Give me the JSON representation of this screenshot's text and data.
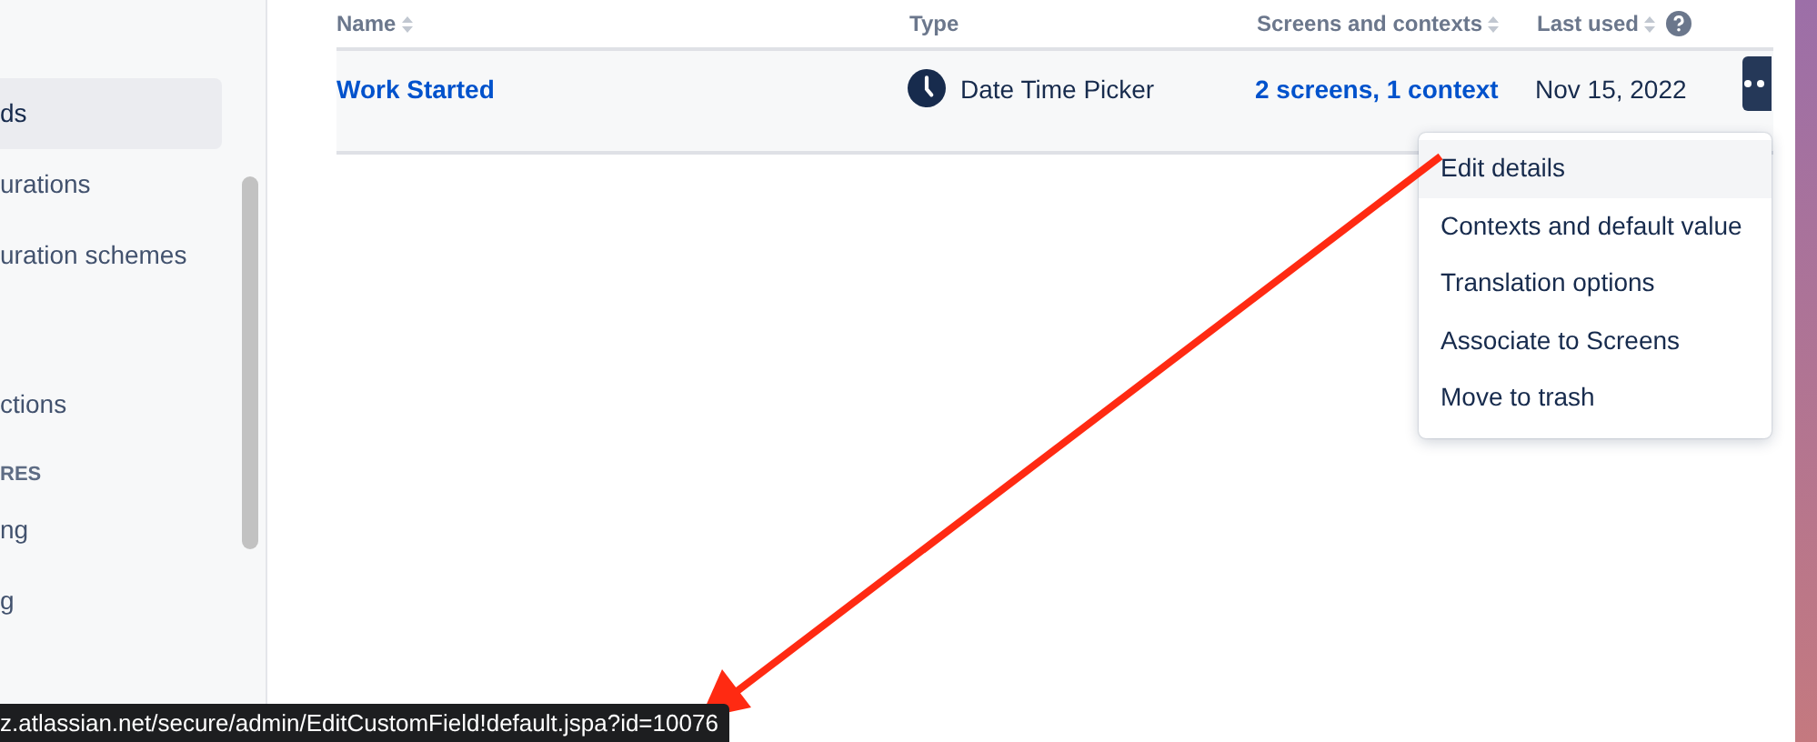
{
  "sidebar": {
    "items": [
      {
        "kind": "item",
        "label": "ds",
        "selected": true
      },
      {
        "kind": "item",
        "label": "urations",
        "selected": false
      },
      {
        "kind": "item",
        "label": "uration schemes",
        "selected": false
      },
      {
        "kind": "gap"
      },
      {
        "kind": "item",
        "label": "ctions",
        "selected": false
      },
      {
        "kind": "header",
        "label": "RES"
      },
      {
        "kind": "item",
        "label": "ng",
        "selected": false
      },
      {
        "kind": "item",
        "label": "g",
        "selected": false
      }
    ]
  },
  "table": {
    "columns": [
      {
        "label": "Name",
        "sortable": true
      },
      {
        "label": "Type",
        "sortable": false
      },
      {
        "label": "Screens and contexts",
        "sortable": true
      },
      {
        "label": "Last used",
        "sortable": true,
        "help": true
      }
    ],
    "rows": [
      {
        "name": "Work Started",
        "type": "Date Time Picker",
        "screens": "2 screens, 1 context",
        "last_used": "Nov 15, 2022",
        "menu_open": true
      }
    ]
  },
  "menu": {
    "items": [
      {
        "label": "Edit details",
        "selected": true
      },
      {
        "label": "Contexts and default value",
        "selected": false
      },
      {
        "label": "Translation options",
        "selected": false
      },
      {
        "label": "Associate to Screens",
        "selected": false
      },
      {
        "label": "Move to trash",
        "selected": false
      }
    ]
  },
  "status_bar": {
    "url": "z.atlassian.net/secure/admin/EditCustomField!default.jspa?id=10076"
  }
}
